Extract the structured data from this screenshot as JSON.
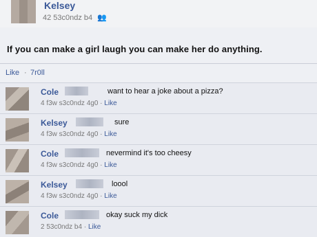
{
  "post": {
    "author": "Kelsey",
    "meta": "42 53c0ndz b4",
    "friends_icon": "👥",
    "text": "If you can make a girl laugh you can make her do anything.",
    "like_label": "Like",
    "separator": "·",
    "timestamp": "7r0ll"
  },
  "comments": [
    {
      "name": "Cole",
      "text": "want to hear a joke about a pizza?",
      "meta": "4 f3w s3c0ndz 4g0",
      "like": "Like"
    },
    {
      "name": "Kelsey",
      "text": "sure",
      "meta": "4 f3w s3c0ndz 4g0",
      "like": "Like"
    },
    {
      "name": "Cole",
      "text": "nevermind it's too cheesy",
      "meta": "4 f3w s3c0ndz 4g0",
      "like": "Like"
    },
    {
      "name": "Kelsey",
      "text": "loool",
      "meta": "4 f3w s3c0ndz 4g0",
      "like": "Like"
    },
    {
      "name": "Cole",
      "text": "okay suck my dick",
      "meta": "2 53c0ndz b4",
      "like": "Like"
    }
  ],
  "colors": {
    "link": "#3b5998",
    "background": "#eef0f4"
  }
}
